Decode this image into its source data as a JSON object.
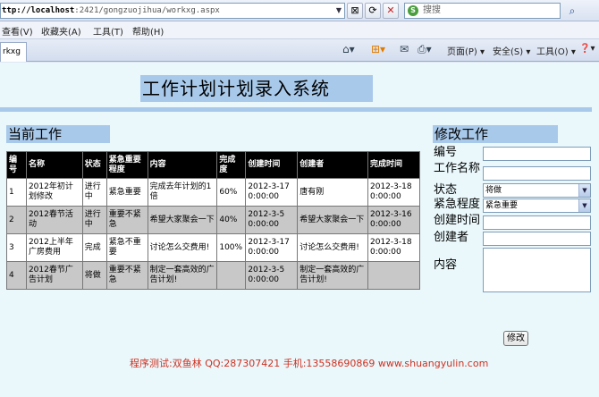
{
  "browser": {
    "address_host": "ttp://localhost",
    "address_rest": ":2421/gongzuojihua/workxg.aspx",
    "search_placeholder": "搜搜",
    "tab_title": "rkxg",
    "menu": [
      "查看(V)",
      "收藏夹(A)",
      "工具(T)",
      "帮助(H)"
    ],
    "commands": {
      "page": "页面(P) ▾",
      "safety": "安全(S) ▾",
      "tools": "工具(O) ▾",
      "help": "❓▾"
    }
  },
  "page": {
    "title": "工作计划计划录入系统",
    "current_section": "当前工作",
    "edit_section": "修改工作",
    "table": {
      "headers": [
        "编号",
        "名称",
        "状态",
        "紧急重要程度",
        "内容",
        "完成度",
        "创建时间",
        "创建者",
        "完成时间"
      ],
      "rows": [
        [
          "1",
          "2012年初计划修改",
          "进行中",
          "紧急重要",
          "完成去年计划的1倍",
          "60%",
          "2012-3-17 0:00:00",
          "唐有刚",
          "2012-3-18 0:00:00"
        ],
        [
          "2",
          "2012春节活动",
          "进行中",
          "重要不紧急",
          "希望大家聚会一下",
          "40%",
          "2012-3-5 0:00:00",
          "希望大家聚会一下",
          "2012-3-16 0:00:00"
        ],
        [
          "3",
          "2012上半年广房费用",
          "完成",
          "紧急不重要",
          "讨论怎么交费用!",
          "100%",
          "2012-3-17 0:00:00",
          "讨论怎么交费用!",
          "2012-3-18 0:00:00"
        ],
        [
          "4",
          "2012春节广告计划",
          "将做",
          "重要不紧急",
          "制定一套高效的广告计划!",
          "",
          "2012-3-5 0:00:00",
          "制定一套高效的广告计划!",
          ""
        ]
      ]
    },
    "form": {
      "id_label": "编号",
      "name_label": "工作名称",
      "status_label": "状态",
      "status_value": "将做",
      "priority_label": "紧急程度",
      "priority_value": "紧急重要",
      "created_time_label": "创建时间",
      "creator_label": "创建者",
      "content_label": "内容",
      "submit_label": "修改"
    },
    "footer": "程序测试:双鱼林 QQ:287307421 手机:13558690869 www.shuangyulin.com"
  }
}
